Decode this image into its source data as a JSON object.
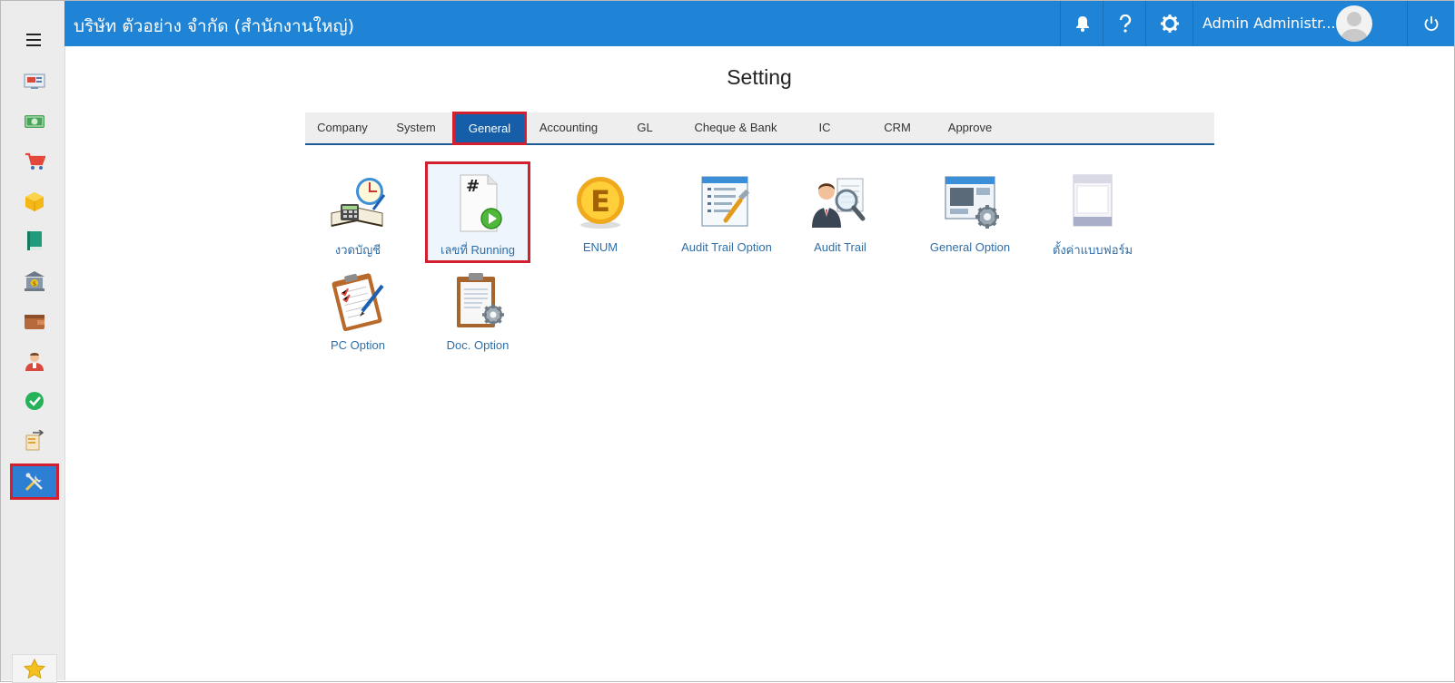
{
  "header": {
    "company": "บริษัท ตัวอย่าง จำกัด (สำนักงานใหญ่)",
    "user_name": "Admin Administr..."
  },
  "page": {
    "title": "Setting"
  },
  "tabs": [
    {
      "label": "Company"
    },
    {
      "label": "System"
    },
    {
      "label": "General",
      "active": true
    },
    {
      "label": "Accounting"
    },
    {
      "label": "GL"
    },
    {
      "label": "Cheque & Bank"
    },
    {
      "label": "IC"
    },
    {
      "label": "CRM"
    },
    {
      "label": "Approve"
    }
  ],
  "items": [
    {
      "label": "งวดบัญชี",
      "icon": "accounting-period-icon"
    },
    {
      "label": "เลขที่ Running",
      "icon": "running-number-icon",
      "selected": true
    },
    {
      "label": "ENUM",
      "icon": "enum-icon"
    },
    {
      "label": "Audit Trail Option",
      "icon": "audit-trail-option-icon"
    },
    {
      "label": "Audit Trail",
      "icon": "audit-trail-icon"
    },
    {
      "label": "General Option",
      "icon": "general-option-icon"
    },
    {
      "label": "ตั้งค่าแบบฟอร์ม",
      "icon": "form-setting-icon"
    },
    {
      "label": "PC Option",
      "icon": "pc-option-icon"
    },
    {
      "label": "Doc. Option",
      "icon": "doc-option-icon"
    }
  ],
  "sidebar": {
    "items": [
      {
        "icon": "dashboard-icon"
      },
      {
        "icon": "money-icon"
      },
      {
        "icon": "cart-icon"
      },
      {
        "icon": "box-icon"
      },
      {
        "icon": "book-icon"
      },
      {
        "icon": "bank-icon"
      },
      {
        "icon": "wallet-icon"
      },
      {
        "icon": "person-icon"
      },
      {
        "icon": "check-icon"
      },
      {
        "icon": "transfer-icon"
      },
      {
        "icon": "tools-icon",
        "active": true
      }
    ],
    "favorite_icon": "star-icon"
  },
  "colors": {
    "header": "#1f84d6",
    "active_tab": "#165ea8",
    "highlight": "#d41f2e",
    "link": "#2f6ea8"
  }
}
